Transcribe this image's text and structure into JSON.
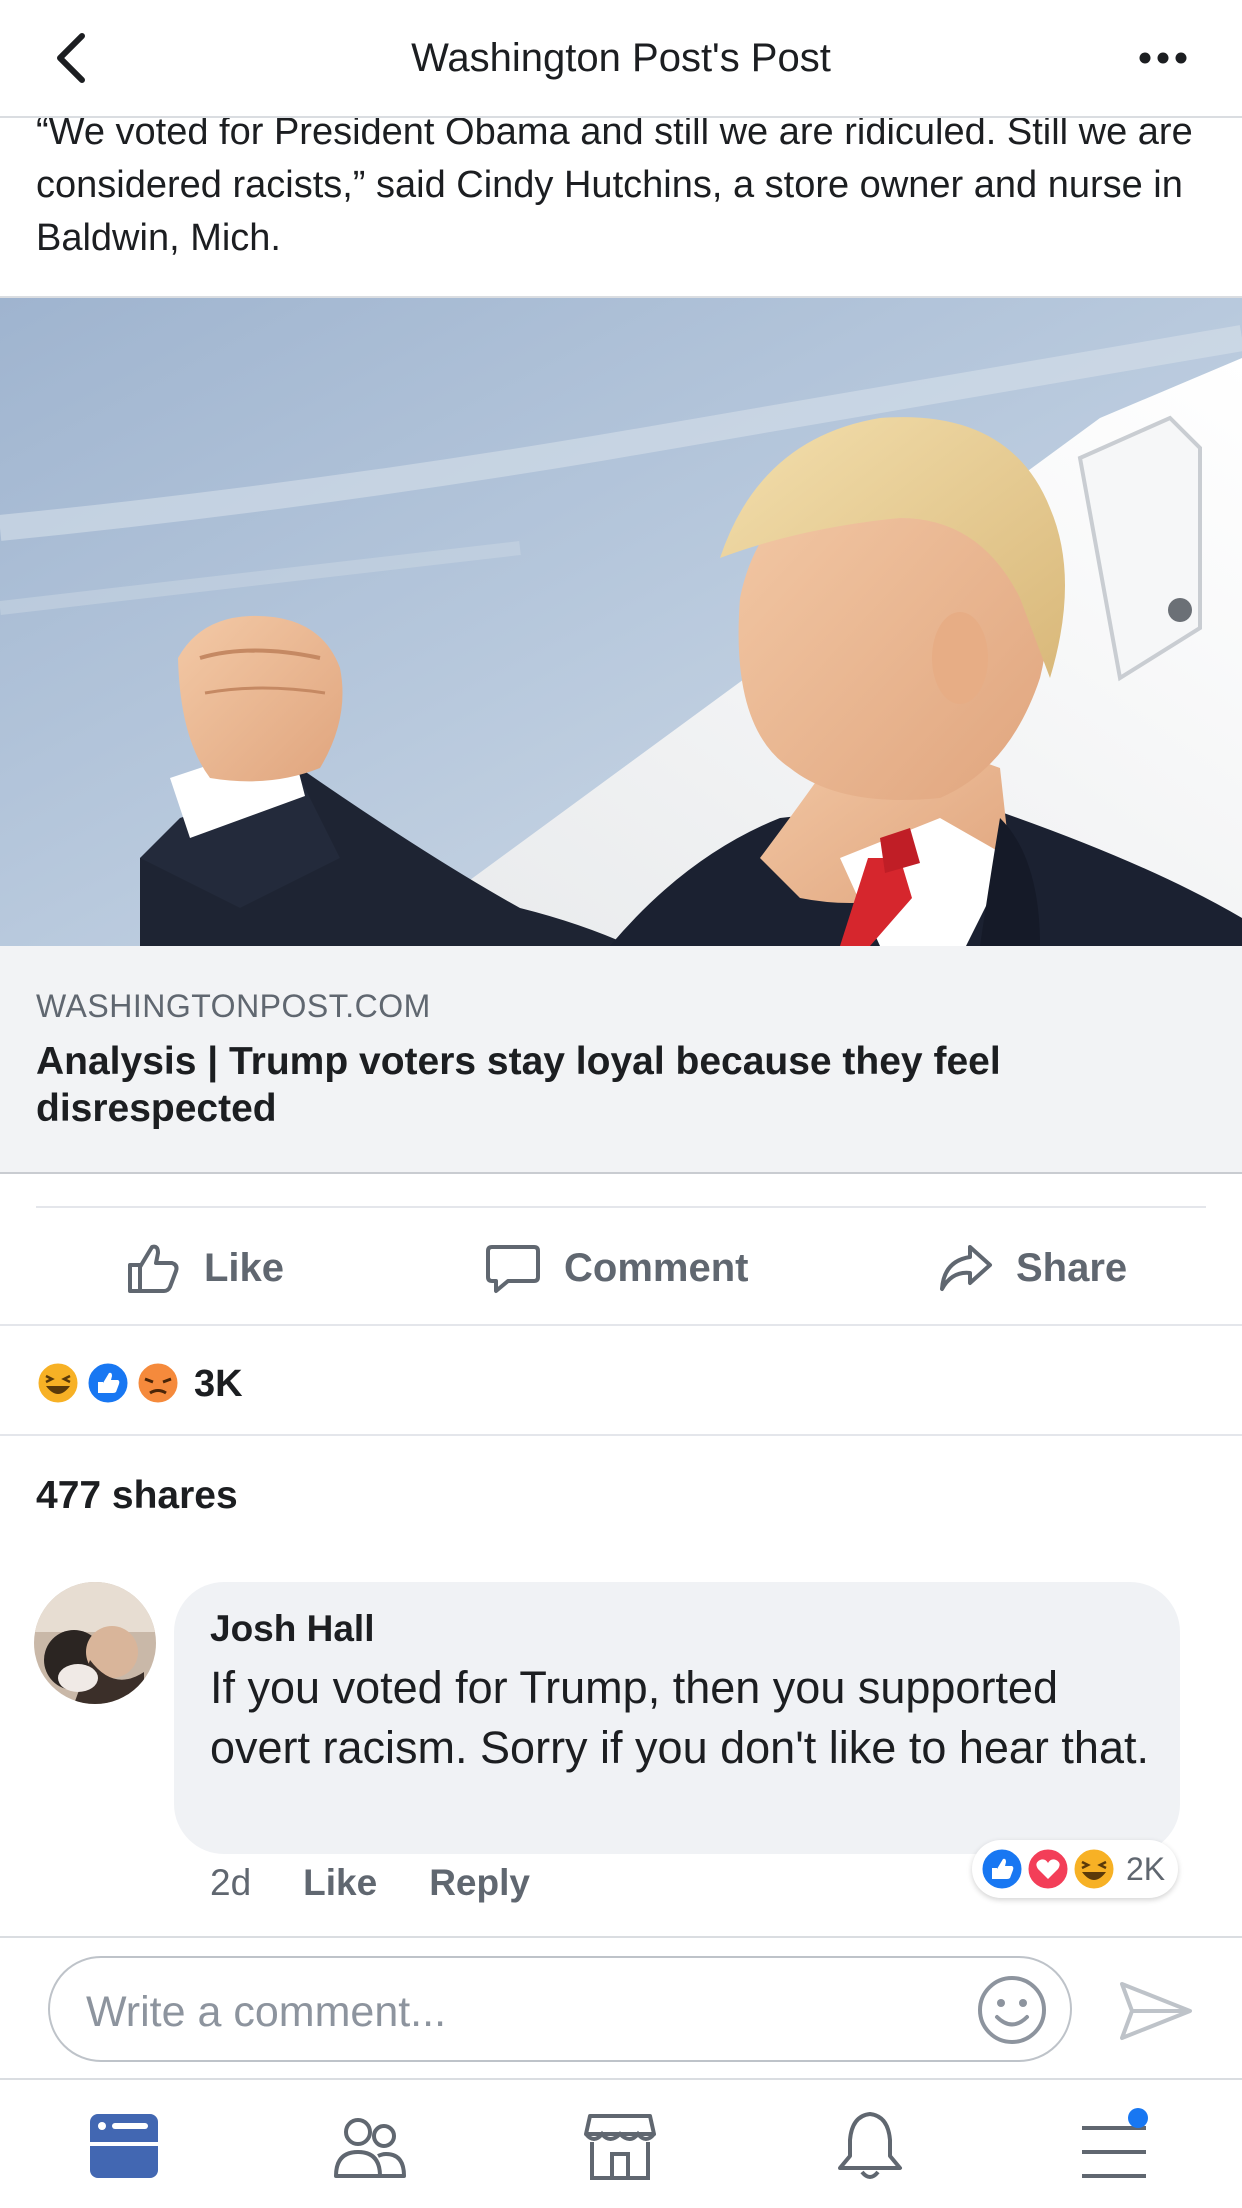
{
  "header": {
    "title": "Washington Post's Post",
    "back_icon": "chevron-left-icon",
    "more_icon": "more-horizontal-icon"
  },
  "post": {
    "text": "“We voted for President Obama and still we are ridiculed. Still we are considered racists,” said Cindy Hutchins, a store owner and nurse in Baldwin, Mich."
  },
  "link_card": {
    "domain": "WASHINGTONPOST.COM",
    "title": "Analysis | Trump voters stay loyal because they feel disrespected"
  },
  "actions": {
    "like": "Like",
    "comment": "Comment",
    "share": "Share"
  },
  "reactions": {
    "icons": [
      "haha-icon",
      "like-icon",
      "angry-icon"
    ],
    "count": "3K"
  },
  "shares": {
    "label": "477 shares"
  },
  "comment": {
    "author": "Josh Hall",
    "text": "If you voted for Trump, then you supported overt racism. Sorry if you don't like to hear that.",
    "time": "2d",
    "like_label": "Like",
    "reply_label": "Reply",
    "reactions": [
      "like-icon",
      "love-icon",
      "haha-icon"
    ],
    "reaction_count": "2K"
  },
  "composer": {
    "placeholder": "Write a comment..."
  },
  "bottom_nav": {
    "items": [
      "news-feed-icon",
      "friends-icon",
      "marketplace-icon",
      "notifications-icon",
      "menu-icon"
    ],
    "active": "news-feed-icon"
  },
  "colors": {
    "brand_blue": "#4267b2",
    "text": "#1c1e21",
    "muted": "#606770",
    "like_blue": "#1877f2",
    "love_red": "#f33e58",
    "haha_yellow": "#f7b125"
  }
}
